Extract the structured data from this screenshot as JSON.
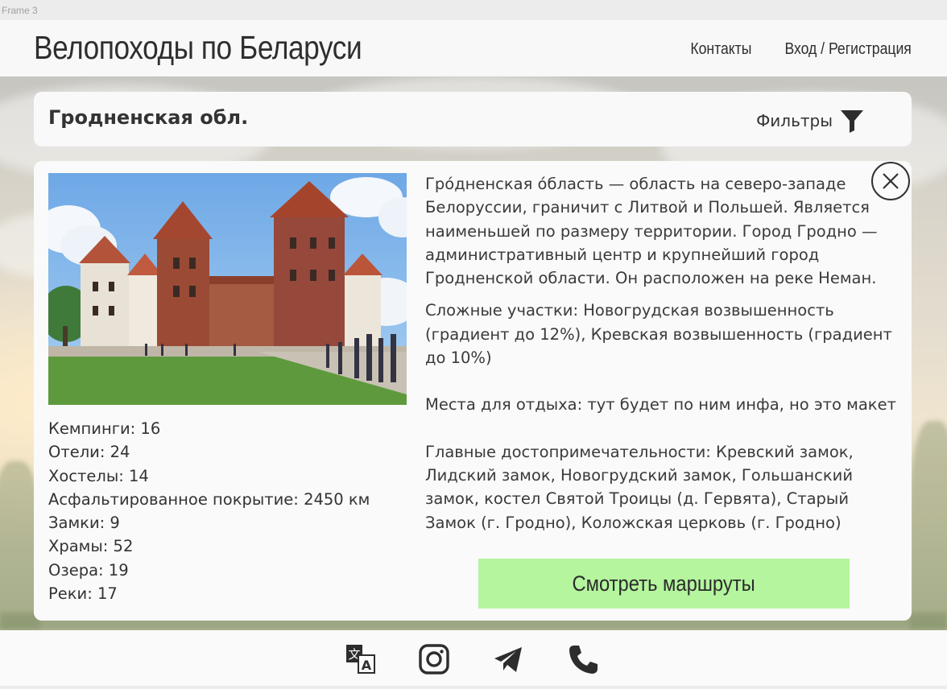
{
  "frame_label": "Frame 3",
  "header": {
    "title": "Велопоходы по Беларуси",
    "nav": {
      "contacts": "Контакты",
      "login": "Вход / Регистрация"
    }
  },
  "region": {
    "title": "Гродненская обл.",
    "filters_label": "Фильтры",
    "filters_icon": "funnel-icon"
  },
  "card": {
    "stats": [
      "Кемпинги: 16",
      "Отели: 24",
      "Хостелы: 14",
      "Асфальтированное покрытие: 2450 км",
      "Замки: 9",
      "Храмы: 52",
      "Озера: 19",
      "Реки: 17"
    ],
    "description": "Гро́дненская о́бласть — область на северо-западе Белоруссии, граничит с Литвой и Польшей. Является наименьшей по размеру территории. Город Гродно — административный центр и крупнейший город Гродненской области. Он расположен на реке Неман.",
    "difficult": "Сложные участки: Новогрудская возвышенность (градиент до 12%), Кревская возвышенность (градиент до 10%)",
    "rest": "Места для отдыха: тут будет по ним инфа, но это макет",
    "sights": "Главные достопримечательности: Кревский замок, Лидский замок, Новогрудский замок, Гольшанский замок, костел Святой Троицы (д. Гервята), Старый Замок (г. Гродно), Коложская церковь (г. Гродно)",
    "routes_button": "Смотреть маршруты",
    "close_icon": "close-icon"
  },
  "footer": {
    "icons": [
      "translate-icon",
      "instagram-icon",
      "telegram-icon",
      "phone-icon"
    ]
  },
  "colors": {
    "accent_button": "#b4f59e",
    "panel": "#fafafa",
    "text": "#2b2b2b"
  }
}
